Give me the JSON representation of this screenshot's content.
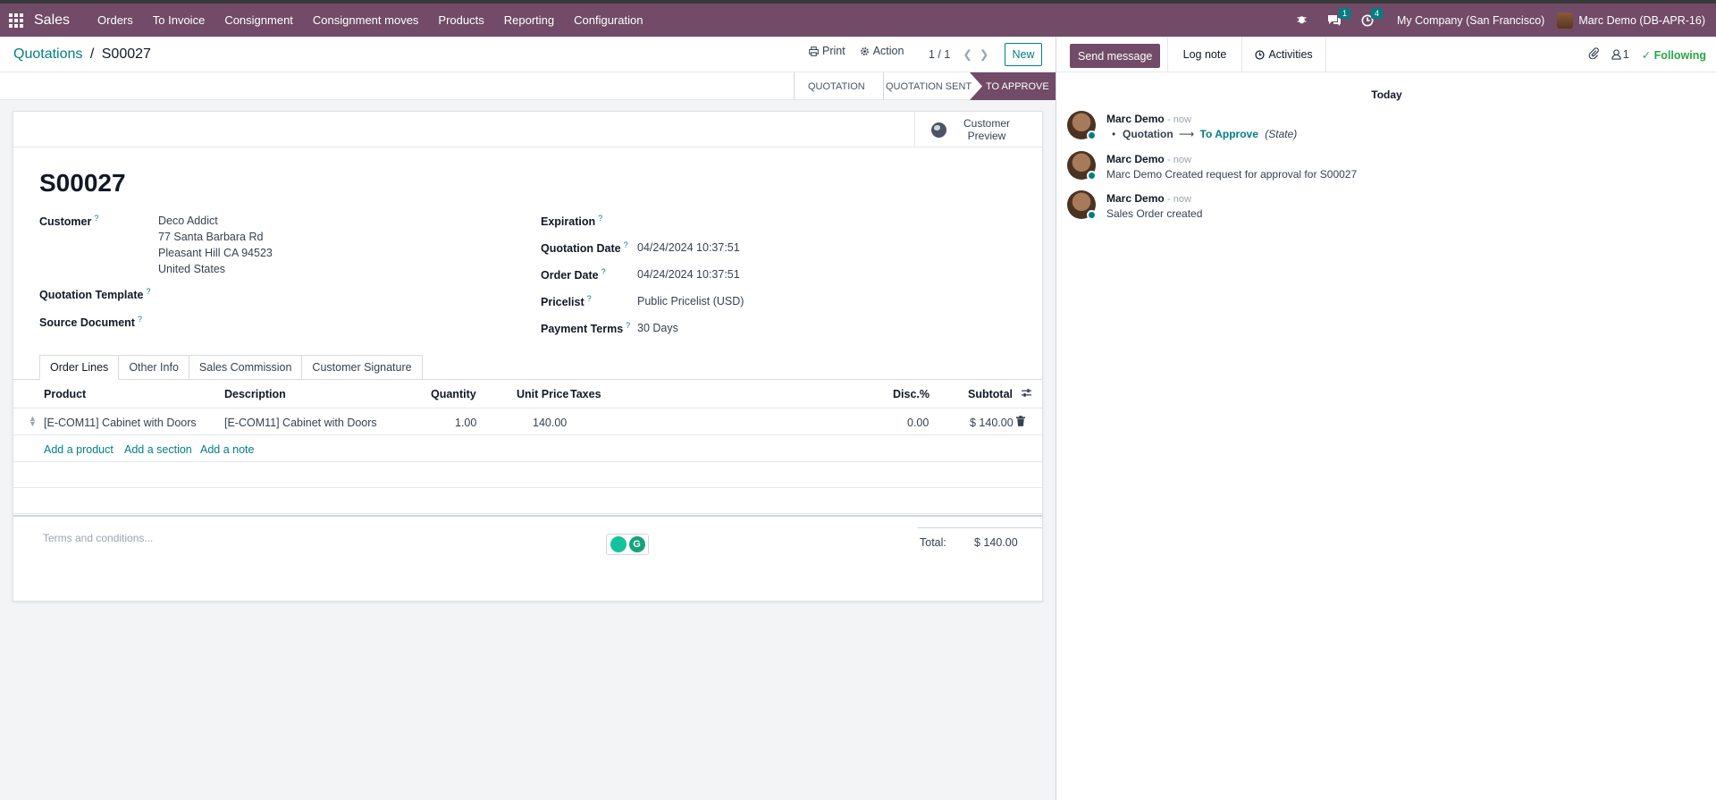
{
  "nav": {
    "brand": "Sales",
    "menu": [
      "Orders",
      "To Invoice",
      "Consignment",
      "Consignment moves",
      "Products",
      "Reporting",
      "Configuration"
    ],
    "messages_count": "1",
    "activities_count": "4",
    "company": "My Company (San Francisco)",
    "user": "Marc Demo (DB-APR-16)"
  },
  "control": {
    "breadcrumb_parent": "Quotations",
    "breadcrumb_sep": "/",
    "breadcrumb_current": "S00027",
    "print": "Print",
    "action": "Action",
    "pager": "1 / 1",
    "new": "New"
  },
  "status": {
    "stages": [
      "QUOTATION",
      "QUOTATION SENT",
      "TO APPROVE"
    ],
    "active": "TO APPROVE"
  },
  "sheet": {
    "customer_preview": "Customer Preview",
    "title": "S00027",
    "customer_label": "Customer",
    "customer_name": "Deco Addict",
    "customer_street": "77 Santa Barbara Rd",
    "customer_city": "Pleasant Hill CA 94523",
    "customer_country": "United States",
    "template_label": "Quotation Template",
    "source_label": "Source Document",
    "expiration_label": "Expiration",
    "quotation_date_label": "Quotation Date",
    "quotation_date": "04/24/2024 10:37:51",
    "order_date_label": "Order Date",
    "order_date": "04/24/2024 10:37:51",
    "pricelist_label": "Pricelist",
    "pricelist": "Public Pricelist (USD)",
    "payment_terms_label": "Payment Terms",
    "payment_terms": "30 Days",
    "help": "?",
    "tabs": [
      "Order Lines",
      "Other Info",
      "Sales Commission",
      "Customer Signature"
    ],
    "columns": {
      "product": "Product",
      "description": "Description",
      "quantity": "Quantity",
      "unit_price": "Unit Price",
      "taxes": "Taxes",
      "disc": "Disc.%",
      "subtotal": "Subtotal"
    },
    "lines": [
      {
        "product": "[E-COM11] Cabinet with Doors",
        "description": "[E-COM11] Cabinet with Doors",
        "quantity": "1.00",
        "unit_price": "140.00",
        "taxes": "",
        "disc": "0.00",
        "subtotal": "$ 140.00"
      }
    ],
    "add_product": "Add a product",
    "add_section": "Add a section",
    "add_note": "Add a note",
    "terms_placeholder": "Terms and conditions...",
    "total_label": "Total:",
    "total_value": "$ 140.00"
  },
  "chatter": {
    "send_message": "Send message",
    "log_note": "Log note",
    "activities": "Activities",
    "followers": "1",
    "following": "Following",
    "today": "Today",
    "messages": [
      {
        "author": "Marc Demo",
        "when": "- now",
        "field": "Quotation",
        "new": "To Approve",
        "field_name": "(State)"
      },
      {
        "author": "Marc Demo",
        "when": "- now",
        "text": "Marc Demo Created request for approval for S00027"
      },
      {
        "author": "Marc Demo",
        "when": "- now",
        "text": "Sales Order created"
      }
    ]
  }
}
